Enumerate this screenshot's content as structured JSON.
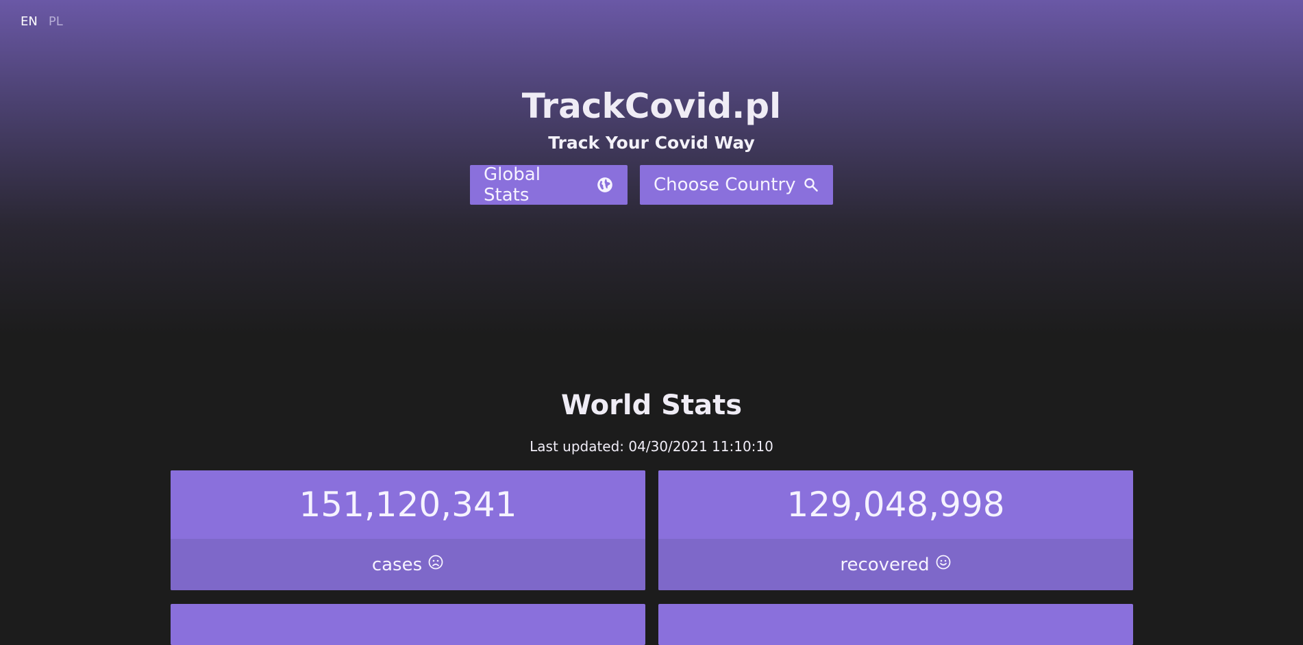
{
  "language_switch": {
    "en": "EN",
    "pl": "PL",
    "active": "EN"
  },
  "header": {
    "title": "TrackCovid.pl",
    "subtitle": "Track Your Covid Way"
  },
  "nav": {
    "global_stats_label": "Global Stats",
    "global_stats_icon": "globe-icon",
    "choose_country_label": "Choose Country",
    "choose_country_icon": "search-icon"
  },
  "world_stats": {
    "title": "World Stats",
    "last_updated": "Last updated: 04/30/2021 11:10:10",
    "cards": [
      {
        "value": "151,120,341",
        "label": "cases",
        "icon": "sad-face-icon"
      },
      {
        "value": "129,048,998",
        "label": "recovered",
        "icon": "smile-face-icon"
      }
    ]
  },
  "colors": {
    "accent": "#8a70dc",
    "accent_dark": "#7e68c9",
    "background": "#1c1c1c",
    "hero_top": "#6a58a6"
  }
}
